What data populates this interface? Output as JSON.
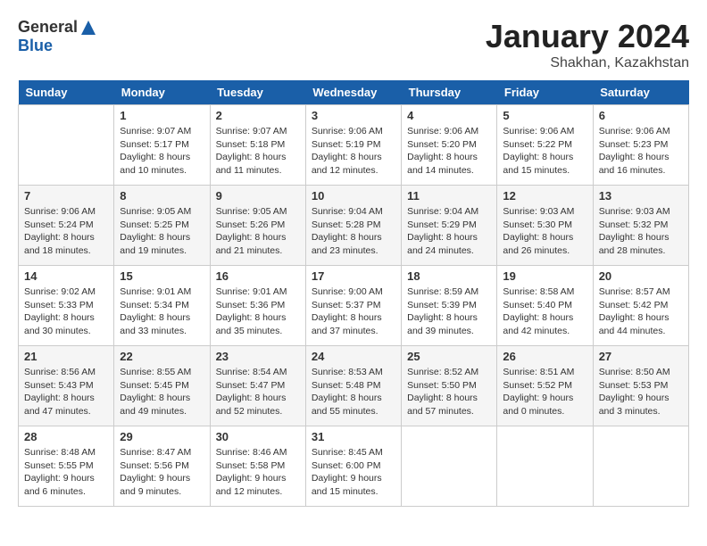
{
  "header": {
    "logo_general": "General",
    "logo_blue": "Blue",
    "title": "January 2024",
    "subtitle": "Shakhan, Kazakhstan"
  },
  "days": [
    "Sunday",
    "Monday",
    "Tuesday",
    "Wednesday",
    "Thursday",
    "Friday",
    "Saturday"
  ],
  "weeks": [
    [
      {
        "date": "",
        "info": ""
      },
      {
        "date": "1",
        "info": "Sunrise: 9:07 AM\nSunset: 5:17 PM\nDaylight: 8 hours\nand 10 minutes."
      },
      {
        "date": "2",
        "info": "Sunrise: 9:07 AM\nSunset: 5:18 PM\nDaylight: 8 hours\nand 11 minutes."
      },
      {
        "date": "3",
        "info": "Sunrise: 9:06 AM\nSunset: 5:19 PM\nDaylight: 8 hours\nand 12 minutes."
      },
      {
        "date": "4",
        "info": "Sunrise: 9:06 AM\nSunset: 5:20 PM\nDaylight: 8 hours\nand 14 minutes."
      },
      {
        "date": "5",
        "info": "Sunrise: 9:06 AM\nSunset: 5:22 PM\nDaylight: 8 hours\nand 15 minutes."
      },
      {
        "date": "6",
        "info": "Sunrise: 9:06 AM\nSunset: 5:23 PM\nDaylight: 8 hours\nand 16 minutes."
      }
    ],
    [
      {
        "date": "7",
        "info": "Sunrise: 9:06 AM\nSunset: 5:24 PM\nDaylight: 8 hours\nand 18 minutes."
      },
      {
        "date": "8",
        "info": "Sunrise: 9:05 AM\nSunset: 5:25 PM\nDaylight: 8 hours\nand 19 minutes."
      },
      {
        "date": "9",
        "info": "Sunrise: 9:05 AM\nSunset: 5:26 PM\nDaylight: 8 hours\nand 21 minutes."
      },
      {
        "date": "10",
        "info": "Sunrise: 9:04 AM\nSunset: 5:28 PM\nDaylight: 8 hours\nand 23 minutes."
      },
      {
        "date": "11",
        "info": "Sunrise: 9:04 AM\nSunset: 5:29 PM\nDaylight: 8 hours\nand 24 minutes."
      },
      {
        "date": "12",
        "info": "Sunrise: 9:03 AM\nSunset: 5:30 PM\nDaylight: 8 hours\nand 26 minutes."
      },
      {
        "date": "13",
        "info": "Sunrise: 9:03 AM\nSunset: 5:32 PM\nDaylight: 8 hours\nand 28 minutes."
      }
    ],
    [
      {
        "date": "14",
        "info": "Sunrise: 9:02 AM\nSunset: 5:33 PM\nDaylight: 8 hours\nand 30 minutes."
      },
      {
        "date": "15",
        "info": "Sunrise: 9:01 AM\nSunset: 5:34 PM\nDaylight: 8 hours\nand 33 minutes."
      },
      {
        "date": "16",
        "info": "Sunrise: 9:01 AM\nSunset: 5:36 PM\nDaylight: 8 hours\nand 35 minutes."
      },
      {
        "date": "17",
        "info": "Sunrise: 9:00 AM\nSunset: 5:37 PM\nDaylight: 8 hours\nand 37 minutes."
      },
      {
        "date": "18",
        "info": "Sunrise: 8:59 AM\nSunset: 5:39 PM\nDaylight: 8 hours\nand 39 minutes."
      },
      {
        "date": "19",
        "info": "Sunrise: 8:58 AM\nSunset: 5:40 PM\nDaylight: 8 hours\nand 42 minutes."
      },
      {
        "date": "20",
        "info": "Sunrise: 8:57 AM\nSunset: 5:42 PM\nDaylight: 8 hours\nand 44 minutes."
      }
    ],
    [
      {
        "date": "21",
        "info": "Sunrise: 8:56 AM\nSunset: 5:43 PM\nDaylight: 8 hours\nand 47 minutes."
      },
      {
        "date": "22",
        "info": "Sunrise: 8:55 AM\nSunset: 5:45 PM\nDaylight: 8 hours\nand 49 minutes."
      },
      {
        "date": "23",
        "info": "Sunrise: 8:54 AM\nSunset: 5:47 PM\nDaylight: 8 hours\nand 52 minutes."
      },
      {
        "date": "24",
        "info": "Sunrise: 8:53 AM\nSunset: 5:48 PM\nDaylight: 8 hours\nand 55 minutes."
      },
      {
        "date": "25",
        "info": "Sunrise: 8:52 AM\nSunset: 5:50 PM\nDaylight: 8 hours\nand 57 minutes."
      },
      {
        "date": "26",
        "info": "Sunrise: 8:51 AM\nSunset: 5:52 PM\nDaylight: 9 hours\nand 0 minutes."
      },
      {
        "date": "27",
        "info": "Sunrise: 8:50 AM\nSunset: 5:53 PM\nDaylight: 9 hours\nand 3 minutes."
      }
    ],
    [
      {
        "date": "28",
        "info": "Sunrise: 8:48 AM\nSunset: 5:55 PM\nDaylight: 9 hours\nand 6 minutes."
      },
      {
        "date": "29",
        "info": "Sunrise: 8:47 AM\nSunset: 5:56 PM\nDaylight: 9 hours\nand 9 minutes."
      },
      {
        "date": "30",
        "info": "Sunrise: 8:46 AM\nSunset: 5:58 PM\nDaylight: 9 hours\nand 12 minutes."
      },
      {
        "date": "31",
        "info": "Sunrise: 8:45 AM\nSunset: 6:00 PM\nDaylight: 9 hours\nand 15 minutes."
      },
      {
        "date": "",
        "info": ""
      },
      {
        "date": "",
        "info": ""
      },
      {
        "date": "",
        "info": ""
      }
    ]
  ]
}
